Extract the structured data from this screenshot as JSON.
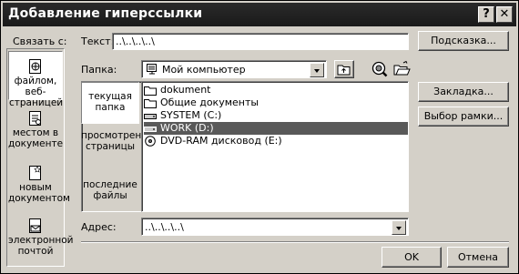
{
  "window": {
    "title": "Добавление гиперссылки",
    "help_label": "?",
    "close_label": "✕"
  },
  "link_to": {
    "label": "Связать с:",
    "items": [
      {
        "label": "файлом, веб-страницей",
        "icon": "globe-page-icon"
      },
      {
        "label": "местом в документе",
        "icon": "document-place-icon"
      },
      {
        "label": "новым документом",
        "icon": "new-document-icon"
      },
      {
        "label": "электронной почтой",
        "icon": "email-icon"
      }
    ]
  },
  "text_field": {
    "label": "Текст:",
    "value": "..\\..\\..\\..\\"
  },
  "folder": {
    "label": "Папка:",
    "value": "Мой компьютер"
  },
  "nav": {
    "items": [
      {
        "label": "текущая папка"
      },
      {
        "label": "просмотренные страницы"
      },
      {
        "label": "последние файлы"
      }
    ]
  },
  "files": [
    {
      "name": "dokument",
      "icon": "folder-icon"
    },
    {
      "name": "Общие документы",
      "icon": "folder-icon"
    },
    {
      "name": "SYSTEM (C:)",
      "icon": "drive-icon"
    },
    {
      "name": "WORK (D:)",
      "icon": "drive-icon"
    },
    {
      "name": "DVD-RAM дисковод (E:)",
      "icon": "dvd-drive-icon"
    }
  ],
  "address": {
    "label": "Адрес:",
    "value": "..\\..\\..\\..\\"
  },
  "buttons": {
    "hint": "Подсказка...",
    "bookmark": "Закладка...",
    "frame": "Выбор рамки...",
    "ok": "OK",
    "cancel": "Отмена"
  }
}
